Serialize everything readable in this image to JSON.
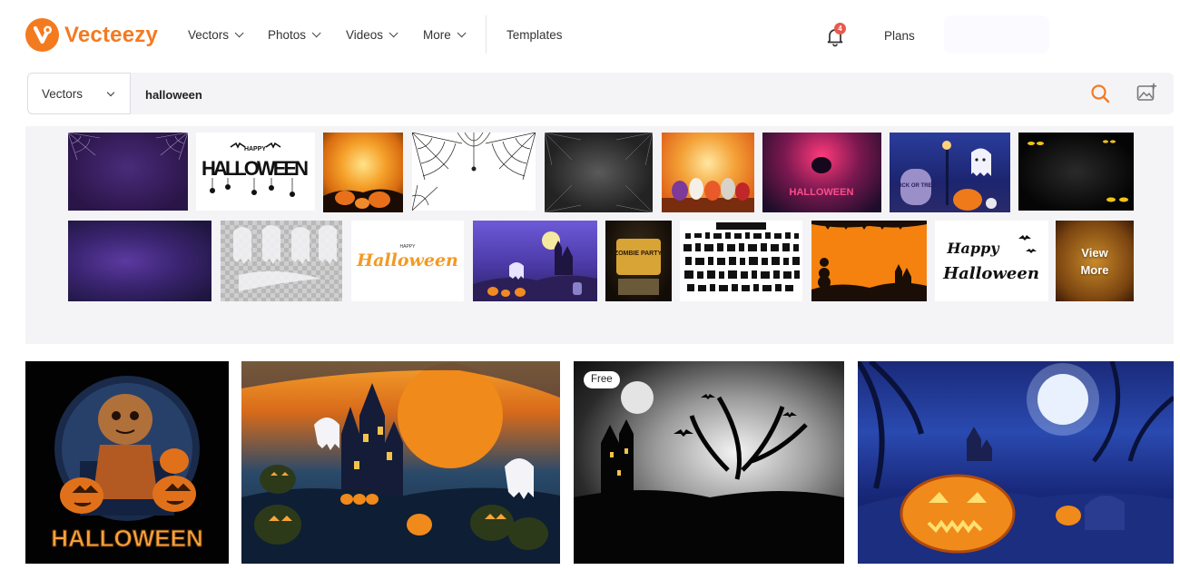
{
  "brand": {
    "name": "Vecteezy",
    "color": "#f47a20"
  },
  "nav": {
    "items": [
      {
        "label": "Vectors",
        "has_dropdown": true
      },
      {
        "label": "Photos",
        "has_dropdown": true
      },
      {
        "label": "Videos",
        "has_dropdown": true
      },
      {
        "label": "More",
        "has_dropdown": true
      }
    ],
    "templates_label": "Templates",
    "notification_count": "4",
    "plans_label": "Plans"
  },
  "search": {
    "type_selected": "Vectors",
    "query": "halloween",
    "icons": [
      "search-icon",
      "image-search-icon"
    ]
  },
  "related": {
    "row1": [
      "spiderweb-purple",
      "happy-halloween-text",
      "full-moon-pumpkins",
      "spider-webs-corners",
      "dark-web-frame",
      "orange-cute-characters",
      "pink-halloween-banner",
      "ghost-tombstone-trick-or-treat",
      "glowing-eyes-dark"
    ],
    "row2": [
      "purple-fog",
      "white-ghosts-transparent",
      "halloween-orange-lettering",
      "purple-haunted-castle",
      "zombie-party-poster",
      "silhouettes-set",
      "orange-frame-pumpkins",
      "happy-halloween-bats",
      "orange-frame-more"
    ],
    "view_more_line1": "View",
    "view_more_line2": "More"
  },
  "results": [
    {
      "name": "scarecrow-pumpkin-tshirt",
      "caption": "HALLOWEEN",
      "free": false
    },
    {
      "name": "haunted-castle-ghosts",
      "free": false
    },
    {
      "name": "castle-moon-bats",
      "free": true,
      "free_label": "Free"
    },
    {
      "name": "blue-night-jack-o-lantern",
      "free": false
    }
  ],
  "thumb_texts": {
    "happy": "HAPPY",
    "halloween_caps": "HALLOWEEN",
    "halloween_pink": "HALLOWEEN",
    "trick": "TRICK OR TREAT",
    "halloween_script": "Halloween",
    "zombie": "ZOMBIE PARTY",
    "happy_script": "Happy",
    "halloween_script2": "Halloween"
  }
}
